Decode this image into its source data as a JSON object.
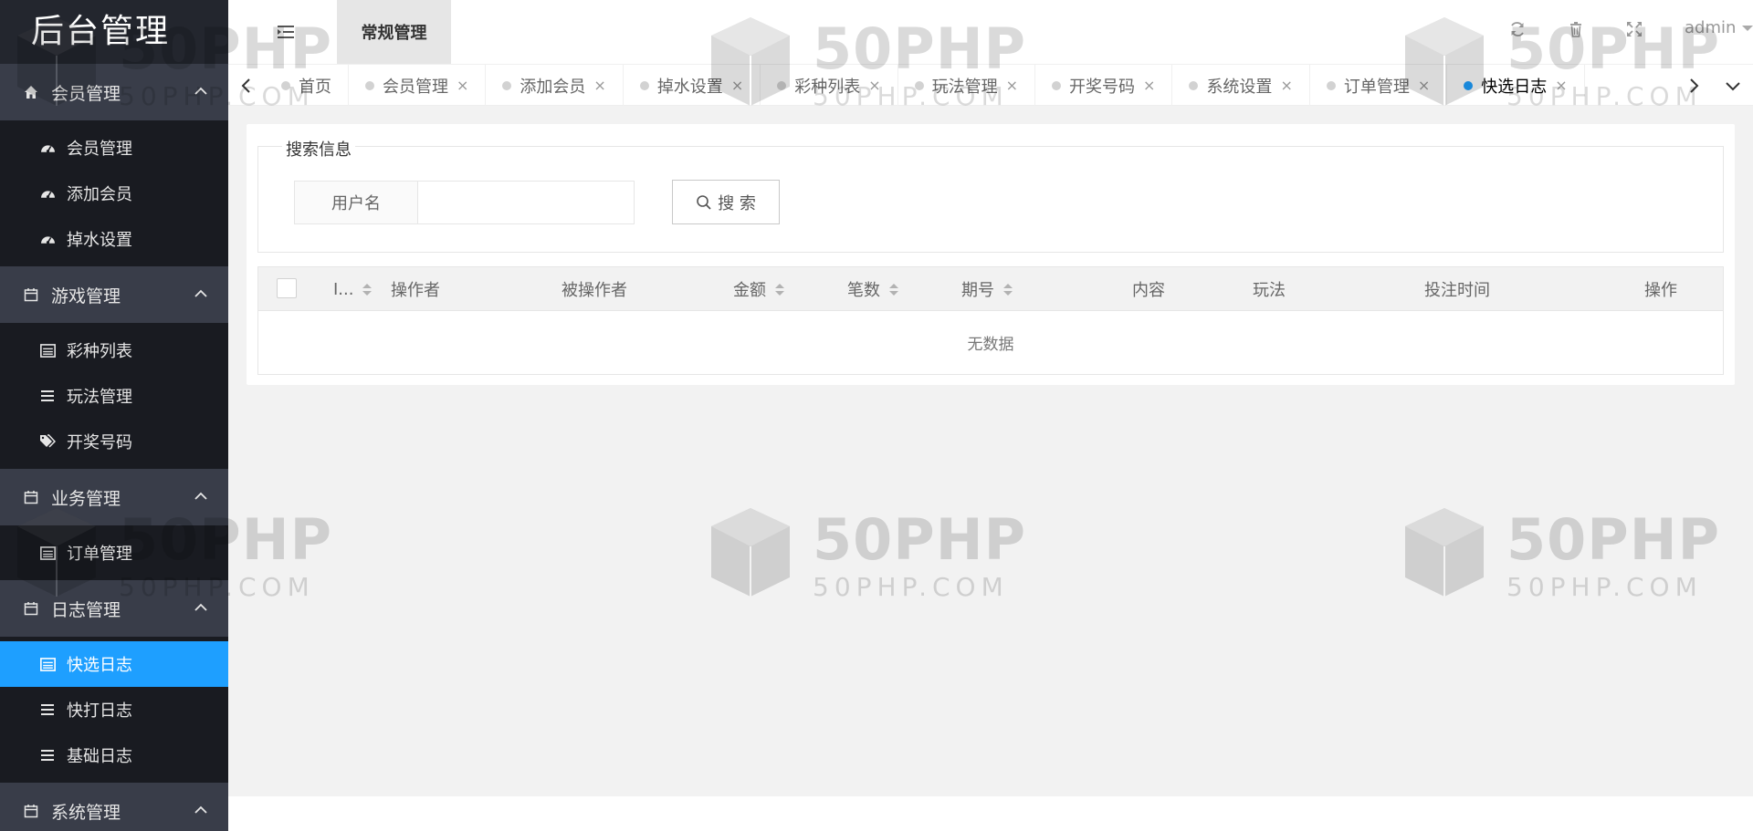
{
  "app": {
    "title": "后台管理"
  },
  "sidebar": {
    "groups": [
      {
        "label": "会员管理",
        "icon": "home-icon",
        "items": [
          {
            "label": "会员管理",
            "icon": "dashboard-icon"
          },
          {
            "label": "添加会员",
            "icon": "dashboard-icon"
          },
          {
            "label": "掉水设置",
            "icon": "dashboard-icon"
          }
        ]
      },
      {
        "label": "游戏管理",
        "icon": "calendar-icon",
        "items": [
          {
            "label": "彩种列表",
            "icon": "list-alt-icon"
          },
          {
            "label": "玩法管理",
            "icon": "bars-icon"
          },
          {
            "label": "开奖号码",
            "icon": "tags-icon"
          }
        ]
      },
      {
        "label": "业务管理",
        "icon": "calendar-icon",
        "items": [
          {
            "label": "订单管理",
            "icon": "list-alt-icon"
          }
        ]
      },
      {
        "label": "日志管理",
        "icon": "calendar-icon",
        "items": [
          {
            "label": "快选日志",
            "icon": "list-alt-icon",
            "active": true
          },
          {
            "label": "快打日志",
            "icon": "bars-icon"
          },
          {
            "label": "基础日志",
            "icon": "bars-icon"
          }
        ]
      },
      {
        "label": "系统管理",
        "icon": "calendar-icon",
        "items": []
      }
    ]
  },
  "header": {
    "menu_tab": "常规管理",
    "user": "admin",
    "icons": [
      "refresh-icon",
      "trash-icon",
      "fullscreen-icon"
    ]
  },
  "tabs": [
    {
      "label": "首页",
      "closable": false
    },
    {
      "label": "会员管理",
      "closable": true
    },
    {
      "label": "添加会员",
      "closable": true
    },
    {
      "label": "掉水设置",
      "closable": true
    },
    {
      "label": "彩种列表",
      "closable": true
    },
    {
      "label": "玩法管理",
      "closable": true
    },
    {
      "label": "开奖号码",
      "closable": true
    },
    {
      "label": "系统设置",
      "closable": true
    },
    {
      "label": "订单管理",
      "closable": true
    },
    {
      "label": "快选日志",
      "closable": true,
      "active": true
    }
  ],
  "tab_close_glyph": "×",
  "search": {
    "legend": "搜索信息",
    "field_label": "用户名",
    "field_value": "",
    "button_label": "搜 索"
  },
  "table": {
    "columns": [
      {
        "label": "I...",
        "sortable": true
      },
      {
        "label": "操作者",
        "sortable": false
      },
      {
        "label": "被操作者",
        "sortable": false
      },
      {
        "label": "金额",
        "sortable": true
      },
      {
        "label": "笔数",
        "sortable": true
      },
      {
        "label": "期号",
        "sortable": true
      },
      {
        "label": "内容",
        "sortable": false
      },
      {
        "label": "玩法",
        "sortable": false
      },
      {
        "label": "投注时间",
        "sortable": false
      },
      {
        "label": "操作",
        "sortable": false
      }
    ],
    "empty_text": "无数据",
    "rows": []
  },
  "watermark": {
    "brand": "50PHP",
    "domain": "50PHP.COM"
  },
  "colors": {
    "sidebar_bg": "#20222a",
    "sidebar_group_bg": "#393d49",
    "active": "#1e9fff",
    "body_bg": "#f2f2f2"
  }
}
